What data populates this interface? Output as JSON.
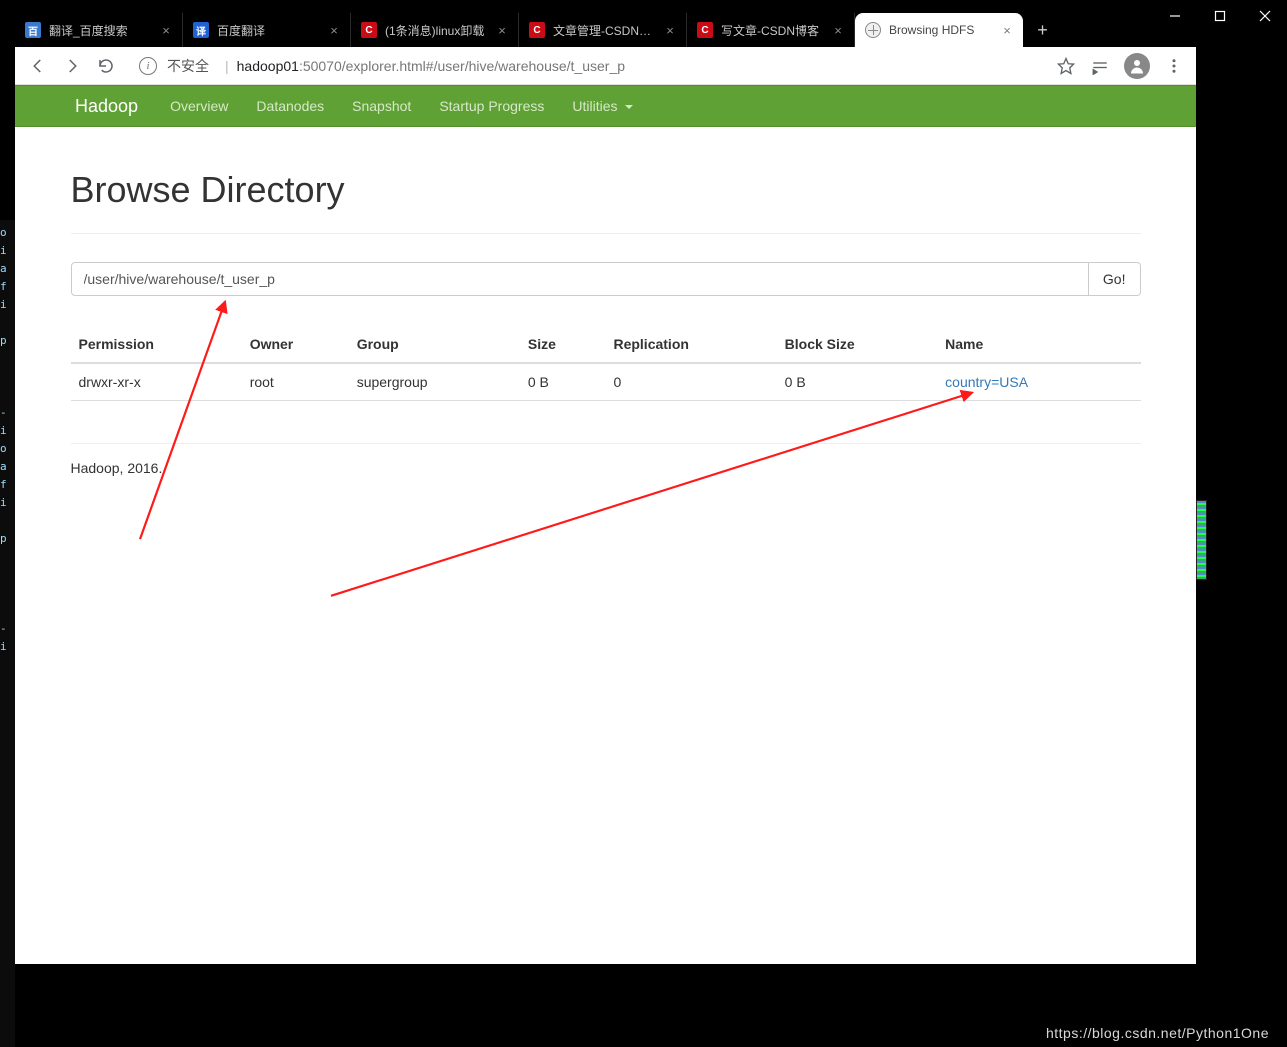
{
  "window": {
    "tabs": [
      {
        "title": "翻译_百度搜索",
        "favicon": "baidu"
      },
      {
        "title": "百度翻译",
        "favicon": "trans"
      },
      {
        "title": "(1条消息)linux卸载",
        "favicon": "csdn"
      },
      {
        "title": "文章管理-CSDN博客",
        "favicon": "csdn"
      },
      {
        "title": "写文章-CSDN博客",
        "favicon": "csdn"
      },
      {
        "title": "Browsing HDFS",
        "favicon": "globe",
        "active": true
      }
    ]
  },
  "address": {
    "insecure_label": "不安全",
    "host": "hadoop01",
    "path": ":50070/explorer.html#/user/hive/warehouse/t_user_p"
  },
  "hadoop": {
    "brand": "Hadoop",
    "nav": {
      "overview": "Overview",
      "datanodes": "Datanodes",
      "snapshot": "Snapshot",
      "startup": "Startup Progress",
      "utilities": "Utilities"
    },
    "page_title": "Browse Directory",
    "path_value": "/user/hive/warehouse/t_user_p",
    "go_label": "Go!",
    "columns": {
      "permission": "Permission",
      "owner": "Owner",
      "group": "Group",
      "size": "Size",
      "replication": "Replication",
      "block_size": "Block Size",
      "name": "Name"
    },
    "rows": [
      {
        "permission": "drwxr-xr-x",
        "owner": "root",
        "group": "supergroup",
        "size": "0 B",
        "replication": "0",
        "block_size": "0 B",
        "name": "country=USA"
      }
    ],
    "footer": "Hadoop, 2016."
  },
  "watermark": "https://blog.csdn.net/Python1One"
}
